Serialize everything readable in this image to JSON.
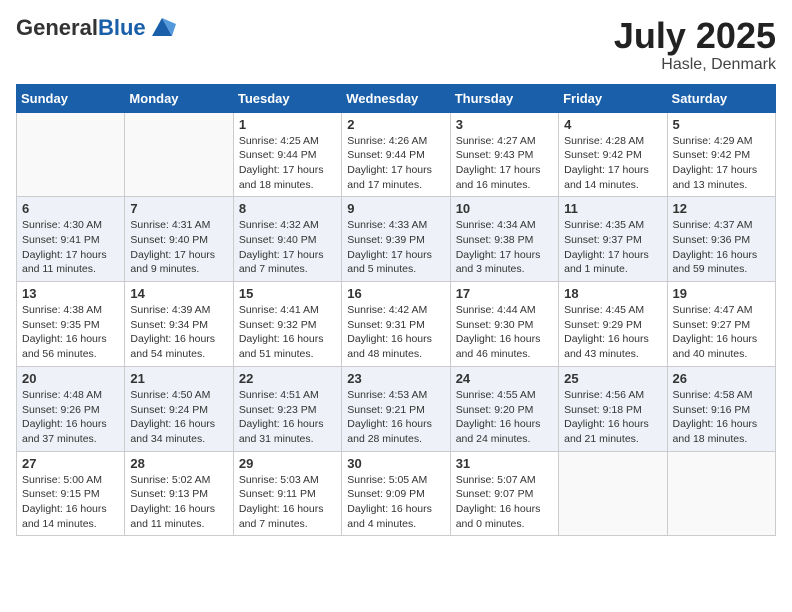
{
  "header": {
    "logo_general": "General",
    "logo_blue": "Blue",
    "title": "July 2025",
    "subtitle": "Hasle, Denmark"
  },
  "weekdays": [
    "Sunday",
    "Monday",
    "Tuesday",
    "Wednesday",
    "Thursday",
    "Friday",
    "Saturday"
  ],
  "weeks": [
    [
      {
        "day": "",
        "info": ""
      },
      {
        "day": "",
        "info": ""
      },
      {
        "day": "1",
        "info": "Sunrise: 4:25 AM\nSunset: 9:44 PM\nDaylight: 17 hours and 18 minutes."
      },
      {
        "day": "2",
        "info": "Sunrise: 4:26 AM\nSunset: 9:44 PM\nDaylight: 17 hours and 17 minutes."
      },
      {
        "day": "3",
        "info": "Sunrise: 4:27 AM\nSunset: 9:43 PM\nDaylight: 17 hours and 16 minutes."
      },
      {
        "day": "4",
        "info": "Sunrise: 4:28 AM\nSunset: 9:42 PM\nDaylight: 17 hours and 14 minutes."
      },
      {
        "day": "5",
        "info": "Sunrise: 4:29 AM\nSunset: 9:42 PM\nDaylight: 17 hours and 13 minutes."
      }
    ],
    [
      {
        "day": "6",
        "info": "Sunrise: 4:30 AM\nSunset: 9:41 PM\nDaylight: 17 hours and 11 minutes."
      },
      {
        "day": "7",
        "info": "Sunrise: 4:31 AM\nSunset: 9:40 PM\nDaylight: 17 hours and 9 minutes."
      },
      {
        "day": "8",
        "info": "Sunrise: 4:32 AM\nSunset: 9:40 PM\nDaylight: 17 hours and 7 minutes."
      },
      {
        "day": "9",
        "info": "Sunrise: 4:33 AM\nSunset: 9:39 PM\nDaylight: 17 hours and 5 minutes."
      },
      {
        "day": "10",
        "info": "Sunrise: 4:34 AM\nSunset: 9:38 PM\nDaylight: 17 hours and 3 minutes."
      },
      {
        "day": "11",
        "info": "Sunrise: 4:35 AM\nSunset: 9:37 PM\nDaylight: 17 hours and 1 minute."
      },
      {
        "day": "12",
        "info": "Sunrise: 4:37 AM\nSunset: 9:36 PM\nDaylight: 16 hours and 59 minutes."
      }
    ],
    [
      {
        "day": "13",
        "info": "Sunrise: 4:38 AM\nSunset: 9:35 PM\nDaylight: 16 hours and 56 minutes."
      },
      {
        "day": "14",
        "info": "Sunrise: 4:39 AM\nSunset: 9:34 PM\nDaylight: 16 hours and 54 minutes."
      },
      {
        "day": "15",
        "info": "Sunrise: 4:41 AM\nSunset: 9:32 PM\nDaylight: 16 hours and 51 minutes."
      },
      {
        "day": "16",
        "info": "Sunrise: 4:42 AM\nSunset: 9:31 PM\nDaylight: 16 hours and 48 minutes."
      },
      {
        "day": "17",
        "info": "Sunrise: 4:44 AM\nSunset: 9:30 PM\nDaylight: 16 hours and 46 minutes."
      },
      {
        "day": "18",
        "info": "Sunrise: 4:45 AM\nSunset: 9:29 PM\nDaylight: 16 hours and 43 minutes."
      },
      {
        "day": "19",
        "info": "Sunrise: 4:47 AM\nSunset: 9:27 PM\nDaylight: 16 hours and 40 minutes."
      }
    ],
    [
      {
        "day": "20",
        "info": "Sunrise: 4:48 AM\nSunset: 9:26 PM\nDaylight: 16 hours and 37 minutes."
      },
      {
        "day": "21",
        "info": "Sunrise: 4:50 AM\nSunset: 9:24 PM\nDaylight: 16 hours and 34 minutes."
      },
      {
        "day": "22",
        "info": "Sunrise: 4:51 AM\nSunset: 9:23 PM\nDaylight: 16 hours and 31 minutes."
      },
      {
        "day": "23",
        "info": "Sunrise: 4:53 AM\nSunset: 9:21 PM\nDaylight: 16 hours and 28 minutes."
      },
      {
        "day": "24",
        "info": "Sunrise: 4:55 AM\nSunset: 9:20 PM\nDaylight: 16 hours and 24 minutes."
      },
      {
        "day": "25",
        "info": "Sunrise: 4:56 AM\nSunset: 9:18 PM\nDaylight: 16 hours and 21 minutes."
      },
      {
        "day": "26",
        "info": "Sunrise: 4:58 AM\nSunset: 9:16 PM\nDaylight: 16 hours and 18 minutes."
      }
    ],
    [
      {
        "day": "27",
        "info": "Sunrise: 5:00 AM\nSunset: 9:15 PM\nDaylight: 16 hours and 14 minutes."
      },
      {
        "day": "28",
        "info": "Sunrise: 5:02 AM\nSunset: 9:13 PM\nDaylight: 16 hours and 11 minutes."
      },
      {
        "day": "29",
        "info": "Sunrise: 5:03 AM\nSunset: 9:11 PM\nDaylight: 16 hours and 7 minutes."
      },
      {
        "day": "30",
        "info": "Sunrise: 5:05 AM\nSunset: 9:09 PM\nDaylight: 16 hours and 4 minutes."
      },
      {
        "day": "31",
        "info": "Sunrise: 5:07 AM\nSunset: 9:07 PM\nDaylight: 16 hours and 0 minutes."
      },
      {
        "day": "",
        "info": ""
      },
      {
        "day": "",
        "info": ""
      }
    ]
  ]
}
